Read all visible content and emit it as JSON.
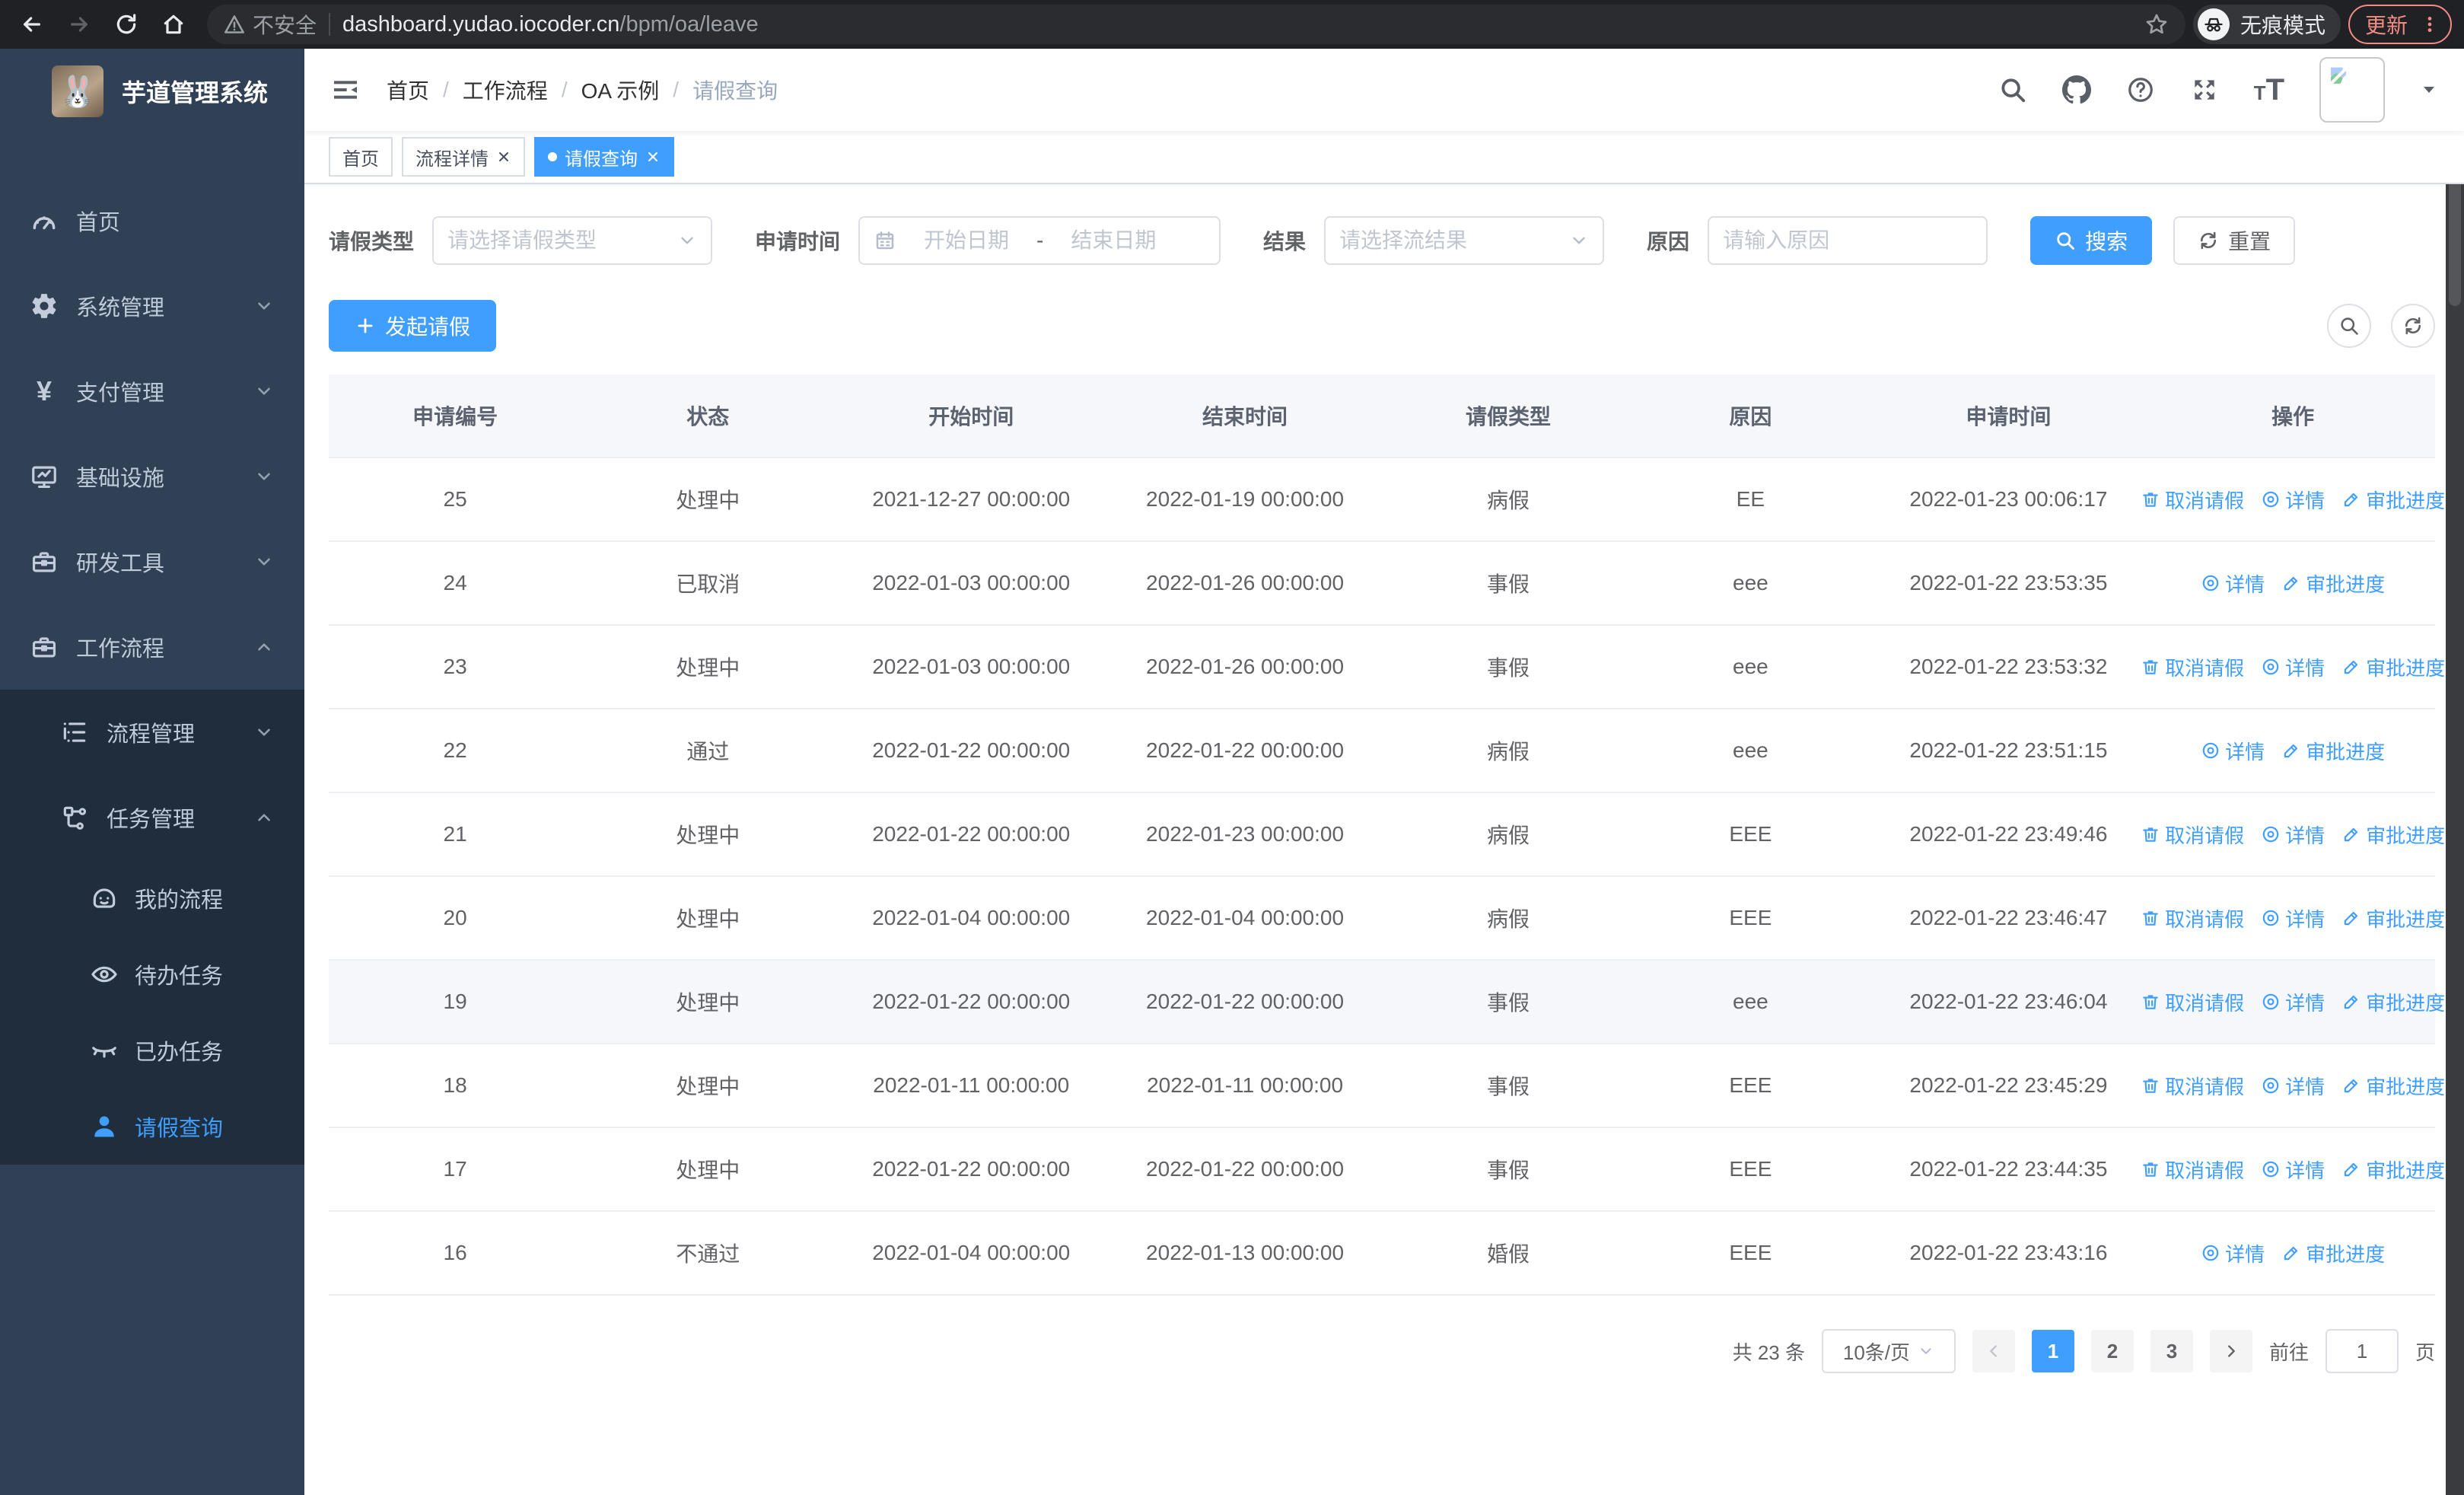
{
  "browser": {
    "security_label": "不安全",
    "url_host": "dashboard.yudao.iocoder.cn",
    "url_path": "/bpm/oa/leave",
    "incognito_label": "无痕模式",
    "update_label": "更新"
  },
  "sidebar": {
    "title": "芋道管理系统",
    "items": [
      {
        "label": "首页"
      },
      {
        "label": "系统管理"
      },
      {
        "label": "支付管理"
      },
      {
        "label": "基础设施"
      },
      {
        "label": "研发工具"
      },
      {
        "label": "工作流程"
      }
    ],
    "submenu": {
      "process_mgmt": {
        "label": "流程管理"
      },
      "task_mgmt": {
        "label": "任务管理"
      },
      "children": [
        {
          "label": "我的流程"
        },
        {
          "label": "待办任务"
        },
        {
          "label": "已办任务"
        },
        {
          "label": "请假查询"
        }
      ]
    }
  },
  "navbar": {
    "breadcrumb": {
      "items": [
        "首页",
        "工作流程",
        "OA 示例",
        "请假查询"
      ],
      "separator": "/"
    }
  },
  "tabs": [
    {
      "label": "首页"
    },
    {
      "label": "流程详情"
    },
    {
      "label": "请假查询"
    }
  ],
  "filters": {
    "leave_type_label": "请假类型",
    "leave_type_placeholder": "请选择请假类型",
    "apply_time_label": "申请时间",
    "start_date_placeholder": "开始日期",
    "range_separator": "-",
    "end_date_placeholder": "结束日期",
    "result_label": "结果",
    "result_placeholder": "请选择流结果",
    "reason_label": "原因",
    "reason_placeholder": "请输入原因",
    "search_label": "搜索",
    "reset_label": "重置"
  },
  "toolbar": {
    "create_label": "发起请假"
  },
  "table": {
    "columns": [
      "申请编号",
      "状态",
      "开始时间",
      "结束时间",
      "请假类型",
      "原因",
      "申请时间",
      "操作"
    ],
    "action_labels": {
      "cancel": "取消请假",
      "detail": "详情",
      "progress": "审批进度"
    },
    "rows": [
      {
        "id": "25",
        "status": "处理中",
        "start": "2021-12-27 00:00:00",
        "end": "2022-01-19 00:00:00",
        "type": "病假",
        "reason": "EE",
        "applied": "2022-01-23 00:06:17"
      },
      {
        "id": "24",
        "status": "已取消",
        "start": "2022-01-03 00:00:00",
        "end": "2022-01-26 00:00:00",
        "type": "事假",
        "reason": "eee",
        "applied": "2022-01-22 23:53:35"
      },
      {
        "id": "23",
        "status": "处理中",
        "start": "2022-01-03 00:00:00",
        "end": "2022-01-26 00:00:00",
        "type": "事假",
        "reason": "eee",
        "applied": "2022-01-22 23:53:32"
      },
      {
        "id": "22",
        "status": "通过",
        "start": "2022-01-22 00:00:00",
        "end": "2022-01-22 00:00:00",
        "type": "病假",
        "reason": "eee",
        "applied": "2022-01-22 23:51:15"
      },
      {
        "id": "21",
        "status": "处理中",
        "start": "2022-01-22 00:00:00",
        "end": "2022-01-23 00:00:00",
        "type": "病假",
        "reason": "EEE",
        "applied": "2022-01-22 23:49:46"
      },
      {
        "id": "20",
        "status": "处理中",
        "start": "2022-01-04 00:00:00",
        "end": "2022-01-04 00:00:00",
        "type": "病假",
        "reason": "EEE",
        "applied": "2022-01-22 23:46:47"
      },
      {
        "id": "19",
        "status": "处理中",
        "start": "2022-01-22 00:00:00",
        "end": "2022-01-22 00:00:00",
        "type": "事假",
        "reason": "eee",
        "applied": "2022-01-22 23:46:04"
      },
      {
        "id": "18",
        "status": "处理中",
        "start": "2022-01-11 00:00:00",
        "end": "2022-01-11 00:00:00",
        "type": "事假",
        "reason": "EEE",
        "applied": "2022-01-22 23:45:29"
      },
      {
        "id": "17",
        "status": "处理中",
        "start": "2022-01-22 00:00:00",
        "end": "2022-01-22 00:00:00",
        "type": "事假",
        "reason": "EEE",
        "applied": "2022-01-22 23:44:35"
      },
      {
        "id": "16",
        "status": "不通过",
        "start": "2022-01-04 00:00:00",
        "end": "2022-01-13 00:00:00",
        "type": "婚假",
        "reason": "EEE",
        "applied": "2022-01-22 23:43:16"
      }
    ]
  },
  "pagination": {
    "total_label": "共 23 条",
    "page_size": "10条/页",
    "pages": [
      "1",
      "2",
      "3"
    ],
    "active_page": "1",
    "goto_label": "前往",
    "goto_value": "1",
    "page_suffix": "页"
  },
  "icons": {
    "yen": "¥",
    "rabbit": "🐰",
    "font_small": "T",
    "font_large": "T"
  },
  "colors": {
    "accent": "#409eff",
    "sidebar_bg": "#304156",
    "submenu_bg": "#1f2d3d",
    "update_chip": "#f28b82",
    "browser_bar": "#202124"
  }
}
